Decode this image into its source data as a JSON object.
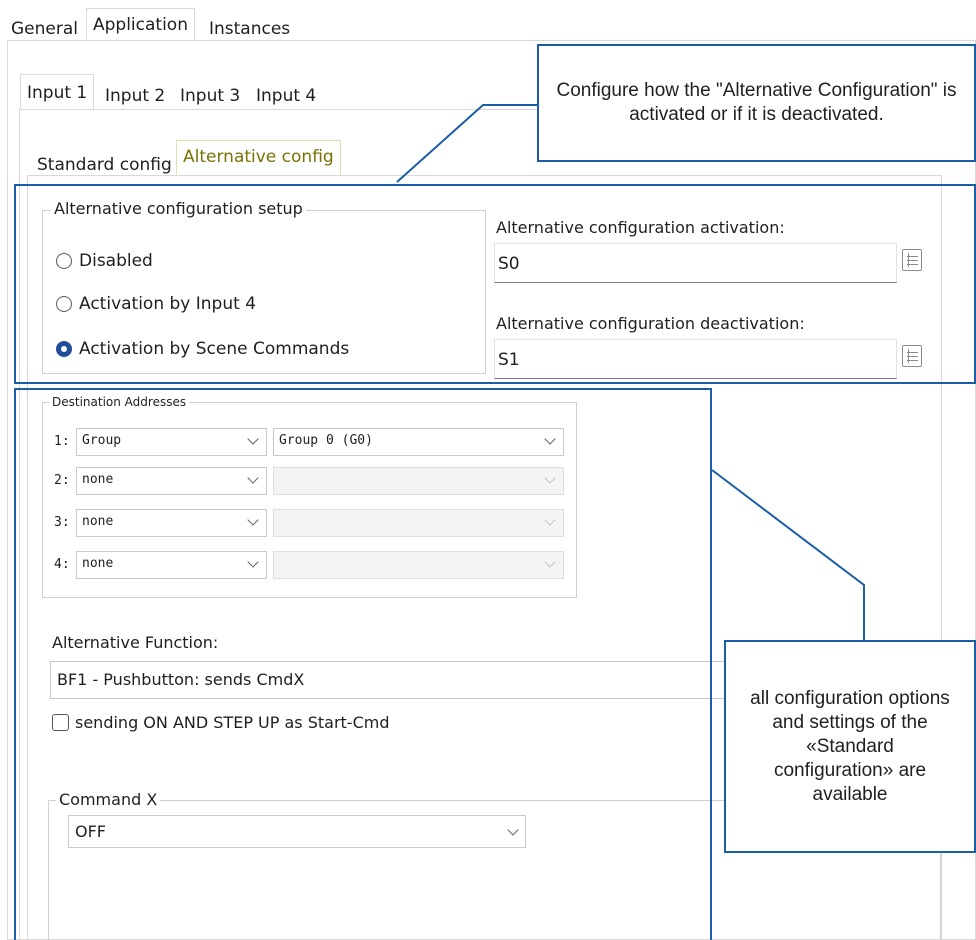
{
  "top_tabs": [
    {
      "label": "General"
    },
    {
      "label": "Application"
    },
    {
      "label": "Instances"
    }
  ],
  "input_tabs": [
    {
      "label": "Input 1"
    },
    {
      "label": "Input 2"
    },
    {
      "label": "Input 3"
    },
    {
      "label": "Input 4"
    }
  ],
  "config_tabs": [
    {
      "label": "Standard config"
    },
    {
      "label": "Alternative config"
    }
  ],
  "setup": {
    "legend": "Alternative configuration setup",
    "options": [
      {
        "label": "Disabled",
        "selected": false
      },
      {
        "label": "Activation by Input 4",
        "selected": false
      },
      {
        "label": "Activation by Scene Commands",
        "selected": true
      }
    ]
  },
  "activation": {
    "label": "Alternative configuration activation:",
    "value": "S0",
    "button_icon": "list-icon"
  },
  "deactivation": {
    "label": "Alternative configuration deactivation:",
    "value": "S1",
    "button_icon": "list-icon"
  },
  "destination": {
    "legend": "Destination Addresses",
    "rows": [
      {
        "num": "1:",
        "type": "Group",
        "address": "Group 0 (G0)",
        "address_enabled": true
      },
      {
        "num": "2:",
        "type": "none",
        "address": "",
        "address_enabled": false
      },
      {
        "num": "3:",
        "type": "none",
        "address": "",
        "address_enabled": false
      },
      {
        "num": "4:",
        "type": "none",
        "address": "",
        "address_enabled": false
      }
    ]
  },
  "alt_function": {
    "label": "Alternative Function:",
    "value": "BF1 - Pushbutton:  sends CmdX"
  },
  "checkbox": {
    "label": "sending ON AND STEP UP as Start-Cmd",
    "checked": false
  },
  "command_x": {
    "legend": "Command X",
    "value": "OFF"
  },
  "callouts": {
    "top": "Configure how the \"Alternative Configuration\" is activated or if it is deactivated.",
    "right": "all configuration options and settings of the «Standard configuration» are available"
  },
  "colors": {
    "callout_border": "#1b5ea8",
    "highlight": "#fbf17c",
    "radio_selected": "#1f4f9a"
  }
}
